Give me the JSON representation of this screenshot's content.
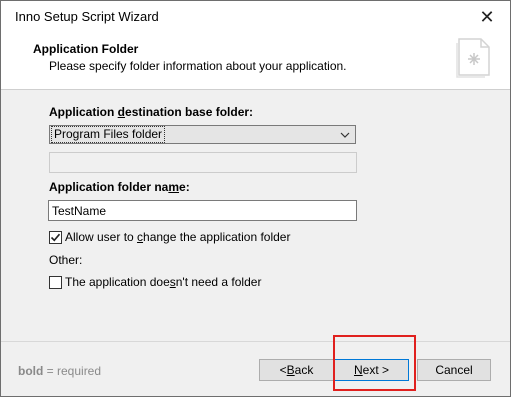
{
  "window": {
    "title": "Inno Setup Script Wizard",
    "close_glyph": "✕"
  },
  "header": {
    "title": "Application Folder",
    "subtitle": "Please specify folder information about your application.",
    "icon": "setup-document-icon"
  },
  "form": {
    "base_folder": {
      "label_pre": "Application ",
      "label_ul": "d",
      "label_post": "estination base folder:",
      "selected": "Program Files folder"
    },
    "custom_folder_value": "",
    "folder_name": {
      "label_pre": "Application folder na",
      "label_ul": "m",
      "label_post": "e:",
      "value": "TestName"
    },
    "allow_change": {
      "checked": true,
      "label_pre": "Allow user to ",
      "label_ul": "c",
      "label_post": "hange the application folder"
    },
    "other_label": "Other:",
    "no_folder": {
      "checked": false,
      "label_pre": "The application doe",
      "label_ul": "s",
      "label_post": "n't need a folder"
    }
  },
  "footer": {
    "hint_bold": "bold",
    "hint_rest": " = required",
    "back_pre": "< ",
    "back_ul": "B",
    "back_post": "ack",
    "next_ul": "N",
    "next_post": "ext >",
    "cancel_label": "Cancel"
  },
  "annotation": {
    "highlight_color": "#e0201e",
    "target": "next-button"
  },
  "colors": {
    "accent": "#0078d7",
    "window_bg": "#f0f0f0"
  }
}
